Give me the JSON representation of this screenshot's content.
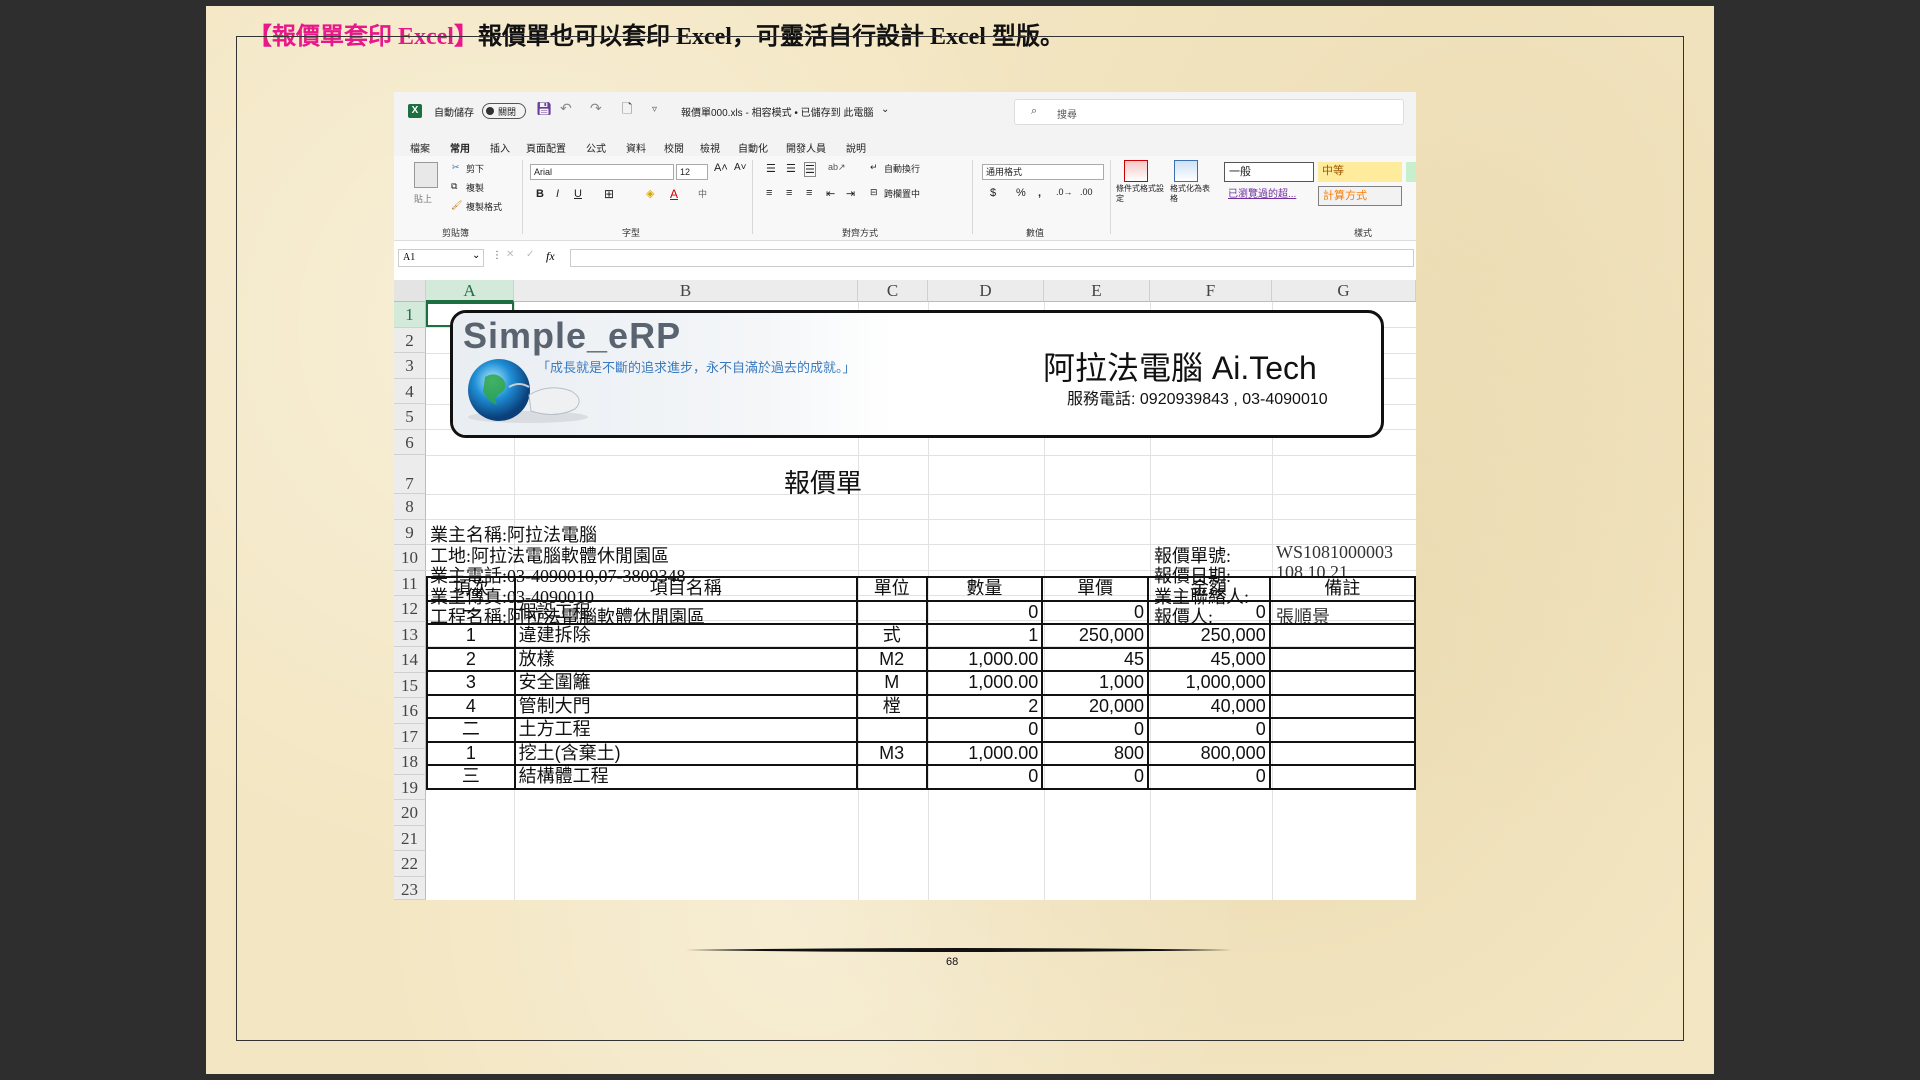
{
  "heading": {
    "tag": "【報價單套印 Excel】",
    "text": "報價單也可以套印 Excel，可靈活自行設計 Excel 型版。"
  },
  "page_number": "68",
  "excel": {
    "titlebar": {
      "autosave": "自動儲存",
      "toggle_state": "關閉",
      "title": "報價單000.xls - 相容模式 • 已儲存到 此電腦",
      "search_placeholder": "搜尋"
    },
    "menu": [
      "檔案",
      "常用",
      "插入",
      "頁面配置",
      "公式",
      "資料",
      "校閱",
      "檢視",
      "自動化",
      "開發人員",
      "說明"
    ],
    "active_menu": "常用",
    "ribbon": {
      "clipboard": {
        "paste": "貼上",
        "cut": "剪下",
        "copy": "複製",
        "format_painter": "複製格式",
        "label": "剪貼簿"
      },
      "font": {
        "name": "Arial",
        "size": "12",
        "label": "字型"
      },
      "alignment": {
        "wrap": "自動換行",
        "merge": "跨欄置中",
        "label": "對齊方式"
      },
      "number": {
        "format": "通用格式",
        "label": "數值"
      },
      "styles": {
        "cond": "條件式格式設定",
        "table": "格式化為表格",
        "normal": "一般",
        "medium": "中等",
        "visited": "已瀏覽過的超...",
        "calc": "計算方式",
        "label": "樣式"
      }
    },
    "name_box": "A1",
    "fx": "fx",
    "columns": [
      "A",
      "B",
      "C",
      "D",
      "E",
      "F",
      "G"
    ],
    "rows": [
      "1",
      "2",
      "3",
      "4",
      "5",
      "6",
      "7",
      "8",
      "9",
      "10",
      "11",
      "12",
      "13",
      "14",
      "15",
      "16",
      "17",
      "18",
      "19",
      "20",
      "21",
      "22",
      "23"
    ],
    "logo": {
      "brand": "Simple_eRP",
      "slogan": "「成長就是不斷的追求進步，永不自滿於過去的成就。」",
      "company": "阿拉法電腦 Ai.Tech",
      "phone_label": "服務電話:",
      "phone": "0920939843 , 03-4090010"
    },
    "doc_title": "報價單",
    "owner_info": [
      "業主名稱:阿拉法電腦",
      "工地:阿拉法電腦軟體休閒園區",
      "業主電話:03-4090010,07-3809348",
      "業主傳真:03-4090010",
      "工程名稱:阿拉法電腦軟體休閒園區"
    ],
    "quote_info": [
      {
        "label": "報價單號:",
        "value": "WS1081000003"
      },
      {
        "label": "報價日期:",
        "value": "108.10.21"
      },
      {
        "label": "業主聯絡人:",
        "value": ""
      },
      {
        "label": "報價人:",
        "value": "張順景"
      }
    ],
    "table": {
      "headers": [
        "項次",
        "項目名稱",
        "單位",
        "數量",
        "單價",
        "金額",
        "備註"
      ],
      "rows": [
        [
          "一",
          "假設工程",
          "",
          "0",
          "0",
          "0",
          ""
        ],
        [
          "1",
          "違建拆除",
          "式",
          "1",
          "250,000",
          "250,000",
          ""
        ],
        [
          "2",
          "放樣",
          "M2",
          "1,000.00",
          "45",
          "45,000",
          ""
        ],
        [
          "3",
          "安全圍籬",
          "M",
          "1,000.00",
          "1,000",
          "1,000,000",
          ""
        ],
        [
          "4",
          "管制大門",
          "樘",
          "2",
          "20,000",
          "40,000",
          ""
        ],
        [
          "二",
          "土方工程",
          "",
          "0",
          "0",
          "0",
          ""
        ],
        [
          "1",
          "挖土(含棄土)",
          "M3",
          "1,000.00",
          "800",
          "800,000",
          ""
        ],
        [
          "三",
          "結構體工程",
          "",
          "0",
          "0",
          "0",
          ""
        ]
      ]
    }
  }
}
